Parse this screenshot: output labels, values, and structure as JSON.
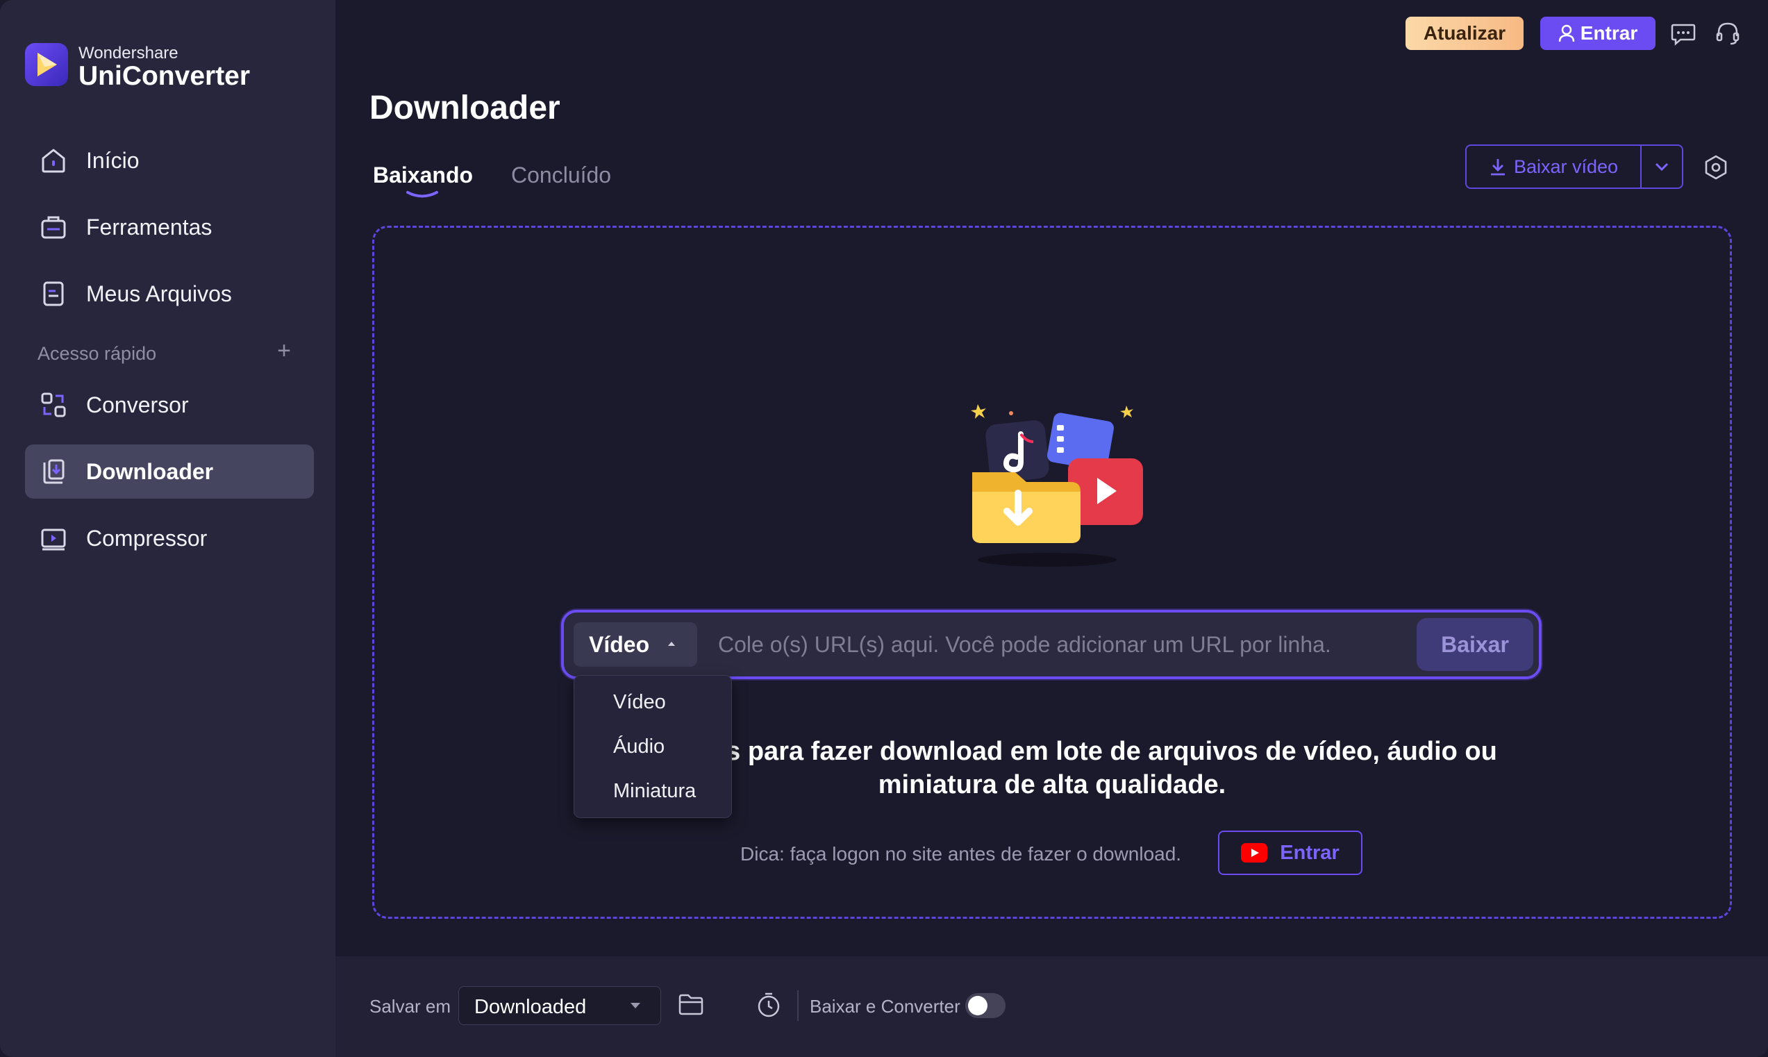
{
  "sidebar": {
    "brand_small": "Wondershare",
    "brand_big": "UniConverter",
    "items": [
      {
        "label": "Início",
        "icon": "home-icon"
      },
      {
        "label": "Ferramentas",
        "icon": "toolbox-icon"
      },
      {
        "label": "Meus Arquivos",
        "icon": "file-icon"
      }
    ],
    "quick_access_label": "Acesso rápido",
    "quick_items": [
      {
        "label": "Conversor",
        "icon": "converter-icon"
      },
      {
        "label": "Downloader",
        "icon": "downloader-icon",
        "active": true
      },
      {
        "label": "Compressor",
        "icon": "compressor-icon"
      }
    ]
  },
  "header": {
    "upgrade_label": "Atualizar",
    "login_label": "Entrar"
  },
  "main": {
    "title": "Downloader",
    "tabs": [
      {
        "label": "Baixando",
        "active": true
      },
      {
        "label": "Concluído",
        "active": false
      }
    ],
    "download_video_label": "Baixar vídeo"
  },
  "url_bar": {
    "type_selected": "Vídeo",
    "placeholder": "Cole o(s) URL(s) aqui. Você pode adicionar um URL por linha.",
    "button_label": "Baixar"
  },
  "type_dropdown": {
    "options": [
      "Vídeo",
      "Áudio",
      "Miniatura"
    ]
  },
  "hero": {
    "line1": "Cole URLs para fazer download em lote de arquivos de vídeo, áudio ou",
    "line2": "miniatura de alta qualidade.",
    "tip": "Dica: faça logon no site antes de fazer o download.",
    "youtube_login_label": "Entrar"
  },
  "bottom": {
    "save_label": "Salvar em",
    "save_value": "Downloaded",
    "convert_label": "Baixar e Converter",
    "convert_enabled": false
  },
  "colors": {
    "accent": "#6a4cf2",
    "sidebar_bg": "#27263d",
    "main_bg": "#1b1a2c"
  }
}
